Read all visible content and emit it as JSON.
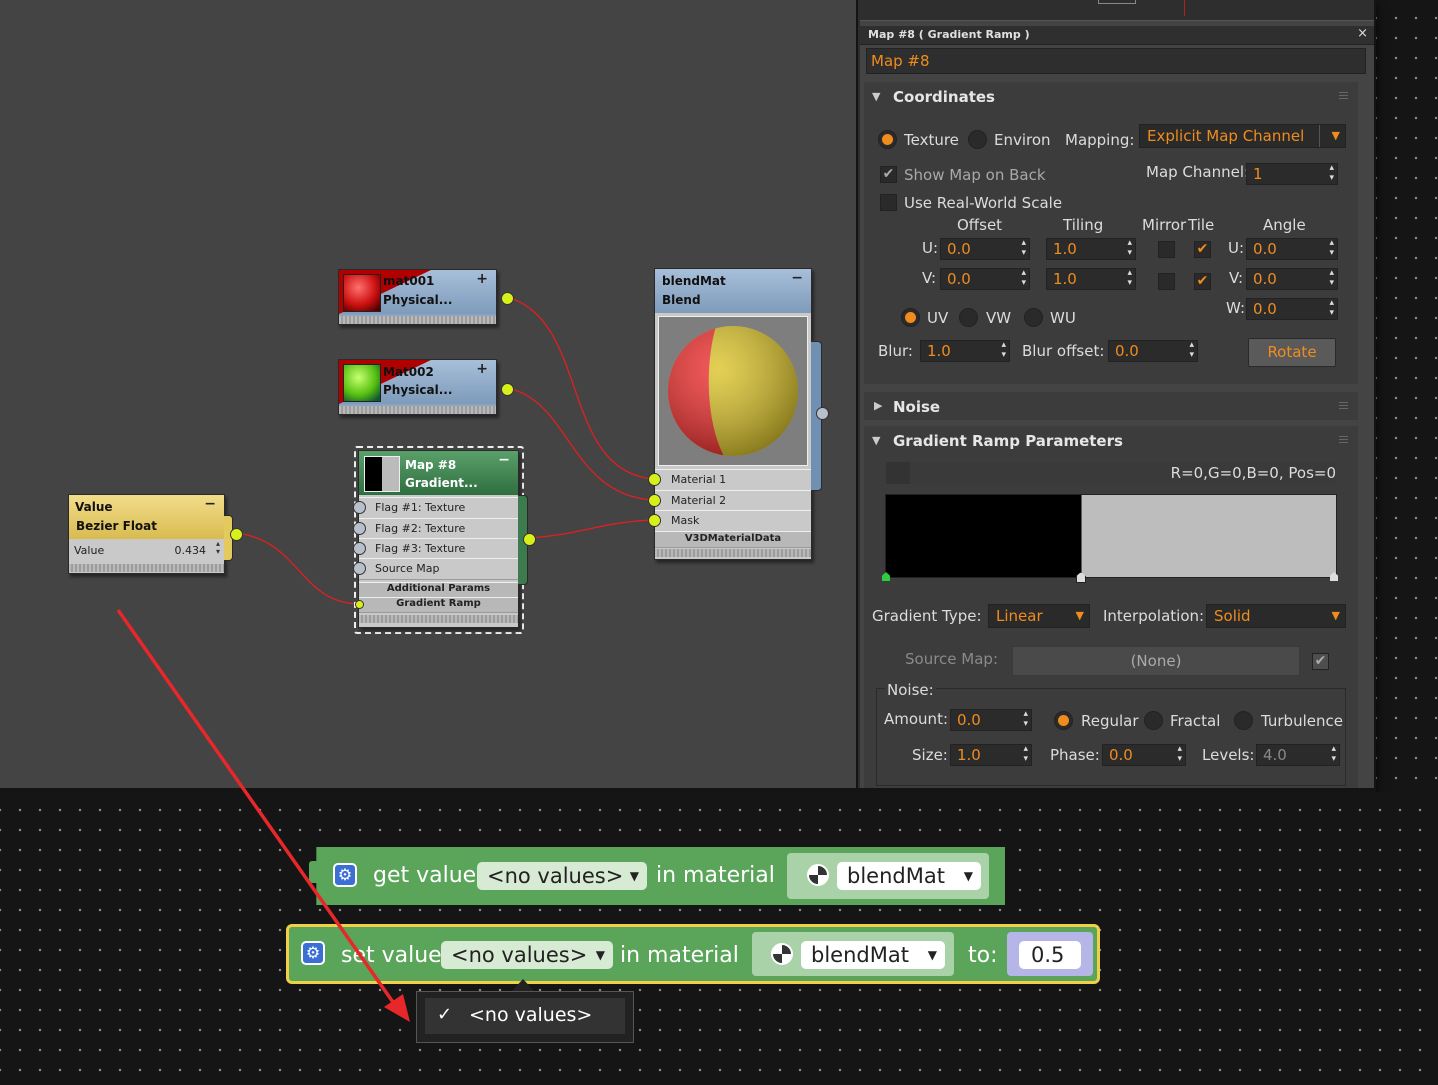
{
  "nodes": {
    "mat001": {
      "name": "mat001",
      "type": "Physical..."
    },
    "mat002": {
      "name": "Mat002",
      "type": "Physical..."
    },
    "map8": {
      "name": "Map #8",
      "type": "Gradient...",
      "inputs": [
        "Flag #1: Texture",
        "Flag #2: Texture",
        "Flag #3: Texture",
        "Source Map"
      ],
      "sections": [
        "Additional Params",
        "Gradient Ramp"
      ]
    },
    "blendmat": {
      "name": "blendMat",
      "type": "Blend",
      "inputs": [
        "Material 1",
        "Material 2",
        "Mask"
      ],
      "section": "V3DMaterialData"
    },
    "value": {
      "name": "Value",
      "type": "Bezier Float",
      "row_label": "Value",
      "row_value": "0.434"
    }
  },
  "panel": {
    "window_title": "Map #8  ( Gradient Ramp )",
    "close_glyph": "×",
    "map_name": "Map #8",
    "coordinates": {
      "title": "Coordinates",
      "texture": "Texture",
      "environ": "Environ",
      "mapping_label": "Mapping:",
      "mapping_value": "Explicit Map Channel",
      "show_map_on_back": "Show Map on Back",
      "map_channel_label": "Map Channel:",
      "map_channel_value": "1",
      "use_real_world": "Use Real-World Scale",
      "offset": "Offset",
      "tiling": "Tiling",
      "mirror": "Mirror",
      "tile": "Tile",
      "angle": "Angle",
      "u_label": "U:",
      "v_label": "V:",
      "w_label": "W:",
      "u_offset": "0.0",
      "v_offset": "0.0",
      "u_tiling": "1.0",
      "v_tiling": "1.0",
      "u_angle": "0.0",
      "v_angle": "0.0",
      "w_angle": "0.0",
      "uv": "UV",
      "vw": "VW",
      "wu": "WU",
      "blur_label": "Blur:",
      "blur_value": "1.0",
      "blur_offset_label": "Blur offset:",
      "blur_offset_value": "0.0",
      "rotate": "Rotate"
    },
    "noise_rollout": "Noise",
    "gradient": {
      "title": "Gradient Ramp Parameters",
      "readout": "R=0,G=0,B=0, Pos=0",
      "gradient_type_label": "Gradient Type:",
      "gradient_type_value": "Linear",
      "interpolation_label": "Interpolation:",
      "interpolation_value": "Solid",
      "source_map_label": "Source Map:",
      "source_map_value": "(None)",
      "noise_label": "Noise:",
      "amount_label": "Amount:",
      "amount_value": "0.0",
      "regular": "Regular",
      "fractal": "Fractal",
      "turbulence": "Turbulence",
      "size_label": "Size:",
      "size_value": "1.0",
      "phase_label": "Phase:",
      "phase_value": "0.0",
      "levels_label": "Levels:",
      "levels_value": "4.0"
    }
  },
  "blocks": {
    "get": {
      "prefix": "get value",
      "dropdown": "<no values>",
      "middle": "in material",
      "material": "blendMat"
    },
    "set": {
      "prefix": "set value",
      "dropdown": "<no values>",
      "middle": "in material",
      "material": "blendMat",
      "to_label": "to:",
      "to_value": "0.5"
    },
    "menu": {
      "check": "✓",
      "item": "<no values>"
    }
  },
  "colors": {
    "accent": "#f08c1e",
    "port": "#d8f01a",
    "wire": "#e02020",
    "block_green": "#5ba55b",
    "arrow": "#e8272a"
  }
}
